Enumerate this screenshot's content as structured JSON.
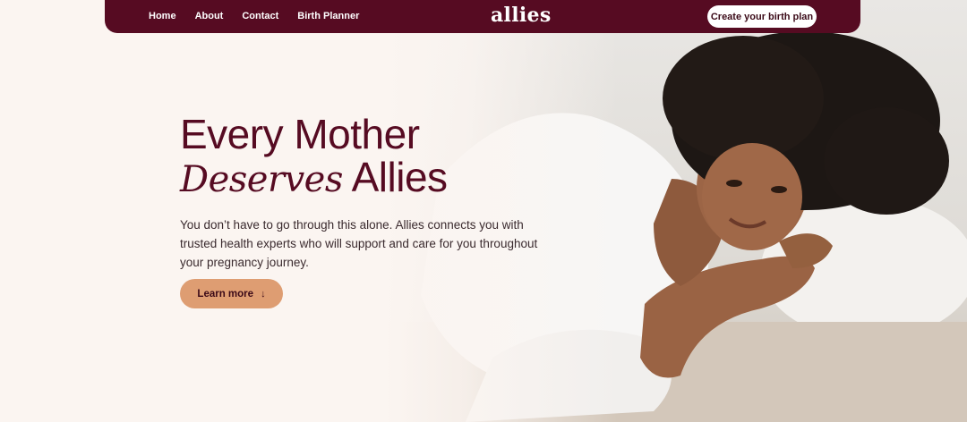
{
  "nav": {
    "links": [
      "Home",
      "About",
      "Contact",
      "Birth Planner"
    ],
    "logo": "allies",
    "cta_label": "Create your birth plan"
  },
  "hero": {
    "title_line1": "Every Mother",
    "title_italic": "Deserves",
    "title_end": "Allies",
    "description": "You don’t have to go through this alone. Allies connects you with trusted health experts who will support and care for you throughout your pregnancy journey.",
    "button_label": "Learn more",
    "button_icon": "arrow-down-icon"
  },
  "colors": {
    "brand": "#560b22",
    "background": "#fbf5f1",
    "accent": "#de9d72"
  }
}
